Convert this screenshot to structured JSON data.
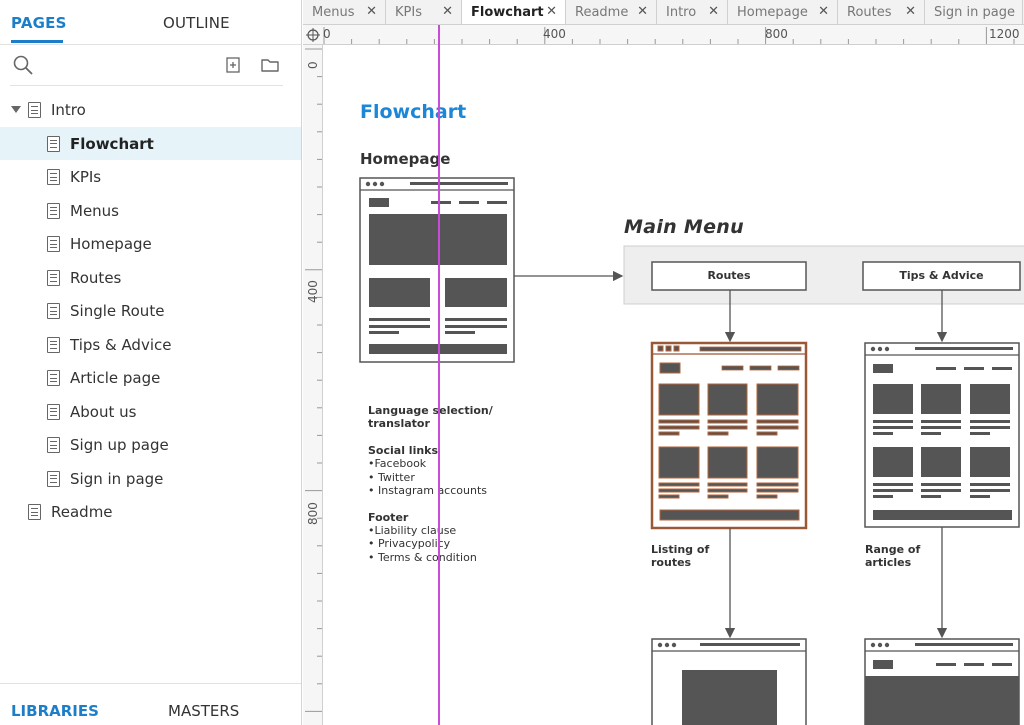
{
  "left_panel": {
    "tabs": [
      "PAGES",
      "OUTLINE"
    ],
    "active_tab": "PAGES",
    "tree": [
      {
        "label": "Intro",
        "level": 0,
        "expanded": true
      },
      {
        "label": "Flowchart",
        "level": 1,
        "selected": true
      },
      {
        "label": "KPIs",
        "level": 1
      },
      {
        "label": "Menus",
        "level": 1
      },
      {
        "label": "Homepage",
        "level": 1
      },
      {
        "label": "Routes",
        "level": 1
      },
      {
        "label": "Single Route",
        "level": 1
      },
      {
        "label": "Tips & Advice",
        "level": 1
      },
      {
        "label": "Article page",
        "level": 1
      },
      {
        "label": "About us",
        "level": 1
      },
      {
        "label": "Sign up page",
        "level": 1
      },
      {
        "label": "Sign in page",
        "level": 1
      },
      {
        "label": "Readme",
        "level": 0
      }
    ],
    "bottom_tabs": [
      "LIBRARIES",
      "MASTERS"
    ],
    "bottom_active": "LIBRARIES"
  },
  "doc_tabs": [
    {
      "label": "Menus",
      "close": "✕"
    },
    {
      "label": "KPIs",
      "close": "✕"
    },
    {
      "label": "Flowchart",
      "close": "✕",
      "active": true
    },
    {
      "label": "Readme",
      "close": "✕"
    },
    {
      "label": "Intro",
      "close": "✕"
    },
    {
      "label": "Homepage",
      "close": "✕"
    },
    {
      "label": "Routes",
      "close": "✕"
    },
    {
      "label": "Sign in page",
      "close": ""
    }
  ],
  "ruler": {
    "top_labels": [
      "0",
      "400",
      "800",
      "1200"
    ],
    "left_labels": [
      "0",
      "400",
      "800"
    ]
  },
  "canvas": {
    "title": "Flowchart",
    "homepage_label": "Homepage",
    "main_menu_label": "Main Menu",
    "menu_items": [
      "Routes",
      "Tips & Advice"
    ],
    "notes": {
      "language_title_1": "Language selection/",
      "language_title_2": "translator",
      "social_title": "Social links",
      "social_items": [
        "•Facebook",
        "• Twitter",
        "• Instagram accounts"
      ],
      "footer_title": "Footer",
      "footer_items": [
        "•Liability clause",
        "• Privacypolicy",
        "• Terms & condition"
      ]
    },
    "captions": {
      "routes_1": "Listing of",
      "routes_2": "routes",
      "tips_1": "Range of",
      "tips_2": "articles"
    }
  },
  "colors": {
    "accent": "#1c7ec9",
    "heading": "#1c87d6",
    "selected_row": "#e6f4f9",
    "guide": "#c94bd9",
    "highlight_frame": "#b5643a",
    "wire_fill": "#555555"
  }
}
